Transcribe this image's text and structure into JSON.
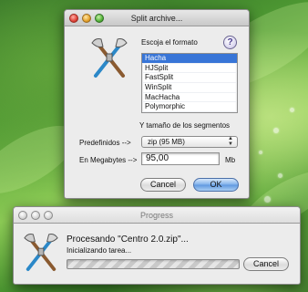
{
  "split_window": {
    "title": "Split archive...",
    "format_label": "Escoja el formato",
    "help_symbol": "?",
    "formats": [
      "Hacha",
      "HJSplit",
      "FastSplit",
      "WinSplit",
      "MacHacha",
      "Polymorphic"
    ],
    "selected_format": "Hacha",
    "segment_size_label": "Y tamaño de los segmentos",
    "presets_label": "Predefinidos -->",
    "preset_value": "zip (95 MB)",
    "megabytes_label": "En Megabytes -->",
    "megabytes_value": "95,00",
    "unit_label": "Mb",
    "cancel_label": "Cancel",
    "ok_label": "OK"
  },
  "progress_window": {
    "title": "Progress",
    "processing_text": "Procesando \"Centro 2.0.zip\"...",
    "status_text": "Inicializando tarea...",
    "progress": 0,
    "cancel_label": "Cancel"
  },
  "icons": {
    "app_icon": "axe-and-tools-icon"
  },
  "colors": {
    "selection": "#3875d7",
    "default_button": "#5e97e0"
  }
}
